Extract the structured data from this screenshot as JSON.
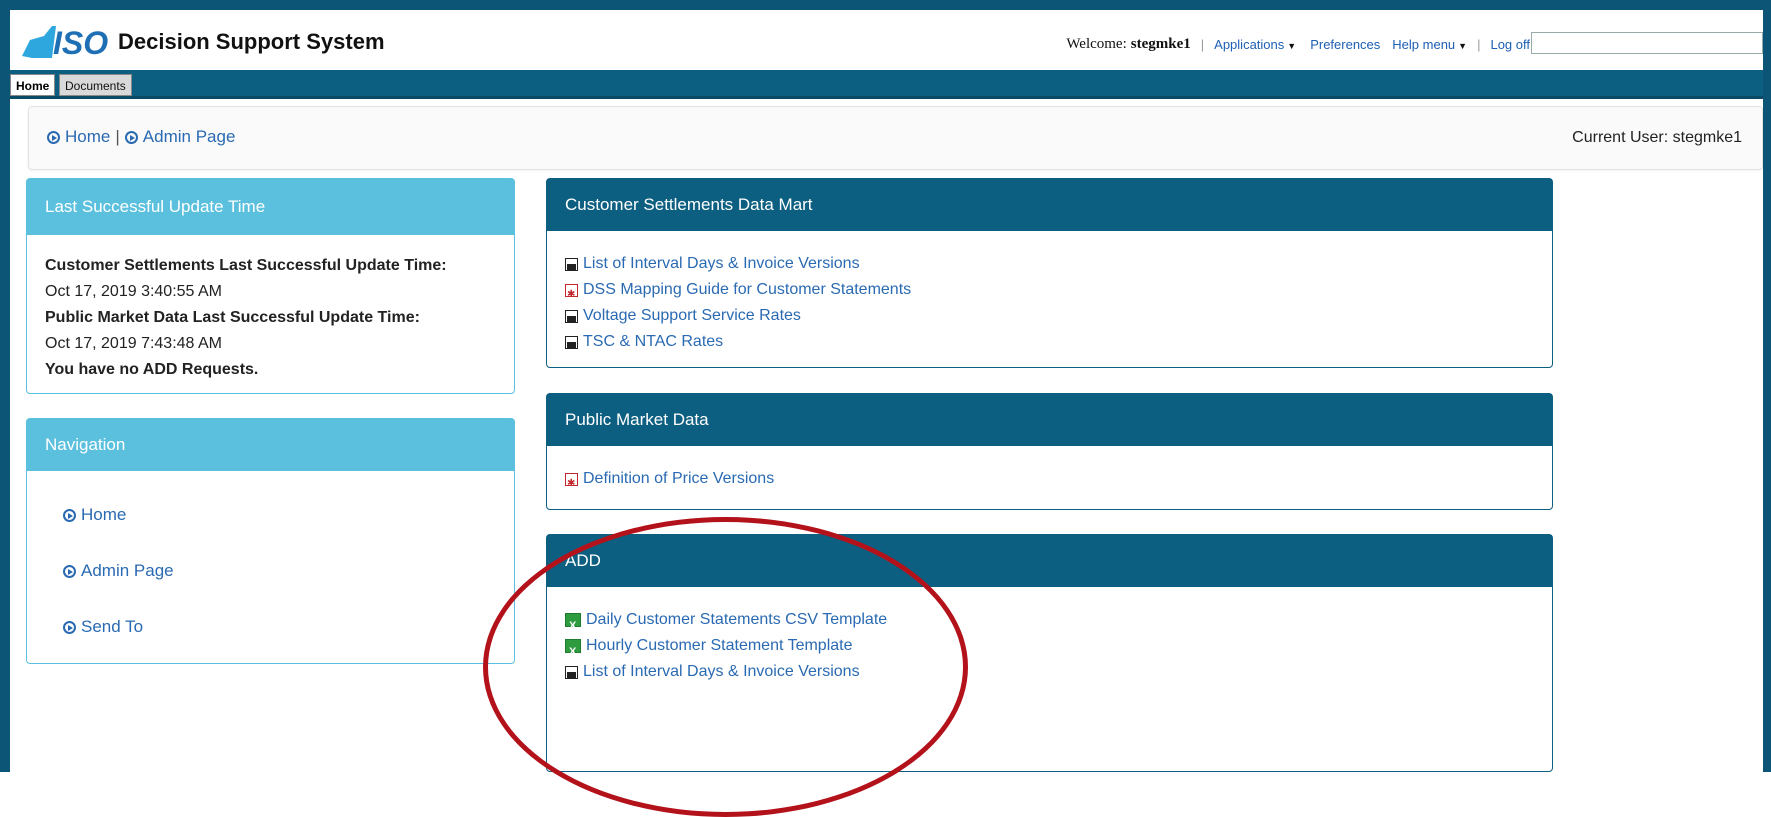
{
  "header": {
    "app_title": "Decision Support System",
    "logo_text": "ISO",
    "welcome_label": "Welcome:",
    "username": "stegmke1",
    "links": {
      "applications": "Applications",
      "preferences": "Preferences",
      "help_menu": "Help menu",
      "log_off": "Log off"
    },
    "search_value": ""
  },
  "tabs": [
    {
      "label": "Home",
      "active": true
    },
    {
      "label": "Documents",
      "active": false
    }
  ],
  "breadcrumb": {
    "items": [
      "Home",
      "Admin Page"
    ],
    "separator": "|",
    "current_user": "Current User: stegmke1"
  },
  "last_update": {
    "title": "Last Successful Update Time",
    "lines": [
      {
        "text": "Customer Settlements Last Successful Update Time:",
        "bold": true
      },
      {
        "text": "Oct 17, 2019 3:40:55 AM",
        "bold": false
      },
      {
        "text": "Public Market Data Last Successful Update Time:",
        "bold": true
      },
      {
        "text": "Oct 17, 2019 7:43:48 AM",
        "bold": false
      },
      {
        "text": "You have no ADD Requests.",
        "bold": true
      }
    ]
  },
  "navigation": {
    "title": "Navigation",
    "items": [
      "Home",
      "Admin Page",
      "Send To"
    ]
  },
  "customer_settlements": {
    "title": "Customer Settlements Data Mart",
    "links": [
      {
        "label": "List of Interval Days & Invoice Versions",
        "icon": "document-icon"
      },
      {
        "label": "DSS Mapping Guide for Customer Statements",
        "icon": "pdf-icon"
      },
      {
        "label": "Voltage Support Service Rates",
        "icon": "document-icon"
      },
      {
        "label": "TSC & NTAC Rates",
        "icon": "document-icon"
      }
    ]
  },
  "public_market": {
    "title": "Public Market Data",
    "links": [
      {
        "label": "Definition of Price Versions",
        "icon": "pdf-icon"
      }
    ]
  },
  "add": {
    "title": "ADD",
    "links": [
      {
        "label": "Daily Customer Statements CSV Template",
        "icon": "excel-icon"
      },
      {
        "label": "Hourly Customer Statement Template",
        "icon": "excel-icon"
      },
      {
        "label": "List of Interval Days & Invoice Versions",
        "icon": "document-icon"
      }
    ]
  },
  "colors": {
    "brand_dark": "#0d5f81",
    "brand_light": "#5bc0de",
    "link": "#2a6ab2",
    "annotation": "#b3121a"
  }
}
